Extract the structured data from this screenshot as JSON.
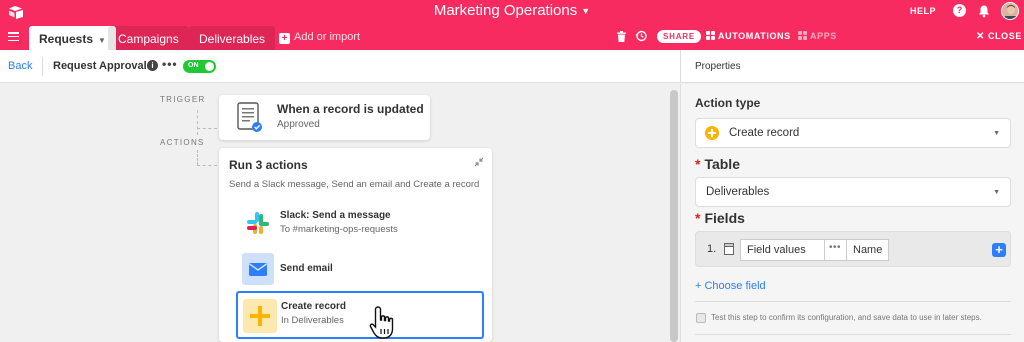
{
  "header": {
    "app_title": "Marketing Operations",
    "help_label": "HELP",
    "help_icon_glyph": "?"
  },
  "tabs": [
    {
      "label": "Requests"
    },
    {
      "label": "Campaigns"
    },
    {
      "label": "Deliverables"
    }
  ],
  "tabbar": {
    "add_import_label": "Add or import",
    "share_label": "SHARE",
    "automations_label": "AUTOMATIONS",
    "apps_label": "APPS",
    "close_label": "CLOSE"
  },
  "toolbar": {
    "back_label": "Back",
    "automation_name": "Request Approvals",
    "toggle_label": "ON"
  },
  "canvas": {
    "trigger_section_label": "TRIGGER",
    "actions_section_label": "ACTIONS",
    "trigger": {
      "title": "When a record is updated",
      "subtitle": "Approved"
    },
    "actions_group": {
      "title": "Run 3 actions",
      "description": "Send a Slack message, Send an email and Create a record",
      "items": [
        {
          "title": "Slack: Send a message",
          "subtitle": "To #marketing-ops-requests",
          "icon": "slack-icon"
        },
        {
          "title": "Send email",
          "subtitle": "",
          "icon": "email-icon"
        },
        {
          "title": "Create record",
          "subtitle": "In Deliverables",
          "icon": "plus-icon"
        }
      ]
    }
  },
  "properties": {
    "header": "Properties",
    "action_type_label": "Action type",
    "action_type_value": "Create record",
    "table_label": "Table",
    "table_value": "Deliverables",
    "fields_label": "Fields",
    "field_row": {
      "index": "1.",
      "field_name": "Field values",
      "value": "Name"
    },
    "choose_field_label": "+ Choose field",
    "test_text": "Test this step to confirm its configuration, and save data to use in later steps."
  },
  "colors": {
    "brand": "#f82b60",
    "accent": "#2d7ff9",
    "toggle_on": "#20c933",
    "yellow": "#fcb400"
  }
}
